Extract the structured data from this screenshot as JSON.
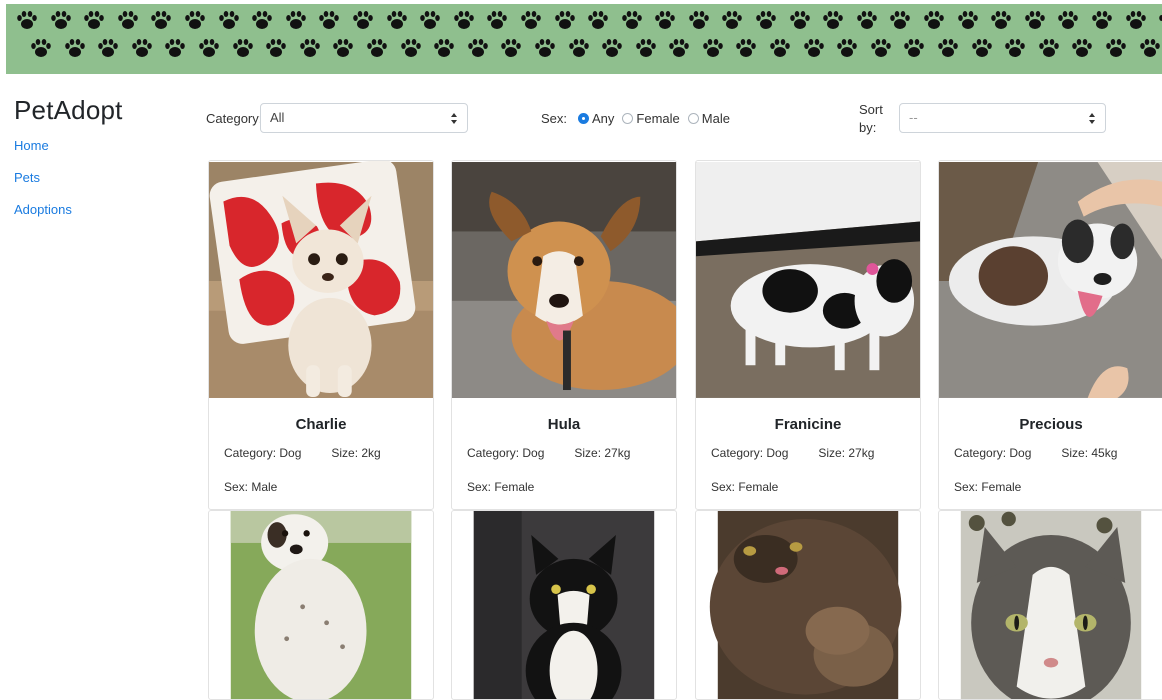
{
  "banner": {
    "icon": "paw-icon",
    "color": "#8fbf8e"
  },
  "brand": "PetAdopt",
  "nav": [
    {
      "label": "Home"
    },
    {
      "label": "Pets"
    },
    {
      "label": "Adoptions"
    }
  ],
  "filters": {
    "category_label": "Category:",
    "category_value": "All",
    "sex_label": "Sex:",
    "sex_options": [
      {
        "label": "Any",
        "checked": true
      },
      {
        "label": "Female",
        "checked": false
      },
      {
        "label": "Male",
        "checked": false
      }
    ],
    "sort_label_1": "Sort",
    "sort_label_2": "by:",
    "sort_value": "--"
  },
  "pets": [
    {
      "name": "Charlie",
      "category": "Category: Dog",
      "size": "Size: 2kg",
      "sex": "Sex: Male",
      "photo": "chihuahua-on-red-pillow"
    },
    {
      "name": "Hula",
      "category": "Category: Dog",
      "size": "Size: 27kg",
      "sex": "Sex: Female",
      "photo": "tan-dog-lying-down"
    },
    {
      "name": "Franicine",
      "category": "Category: Dog",
      "size": "Size: 27kg",
      "sex": "Sex: Female",
      "photo": "black-white-dog-standing"
    },
    {
      "name": "Precious",
      "category": "Category: Dog",
      "size": "Size: 45kg",
      "sex": "Sex: Female",
      "photo": "white-brindle-dog"
    },
    {
      "photo": "white-spotted-dog-sitting"
    },
    {
      "photo": "tuxedo-cat"
    },
    {
      "photo": "long-haired-tortoiseshell-cat"
    },
    {
      "photo": "grey-white-cat-closeup"
    }
  ]
}
